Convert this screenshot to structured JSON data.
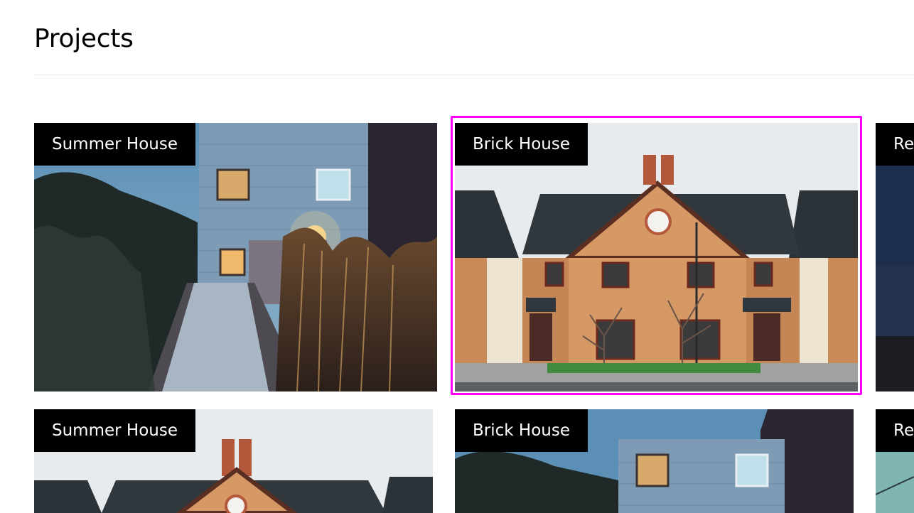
{
  "page": {
    "title": "Projects"
  },
  "projects": [
    {
      "title": "Summer House"
    },
    {
      "title": "Brick House"
    },
    {
      "title": "Re"
    },
    {
      "title": "Summer House"
    },
    {
      "title": "Brick House"
    },
    {
      "title": "Re"
    }
  ],
  "colors": {
    "focus_ring": "#ff00ff",
    "caption_bg": "#000000",
    "caption_text": "#ffffff"
  }
}
